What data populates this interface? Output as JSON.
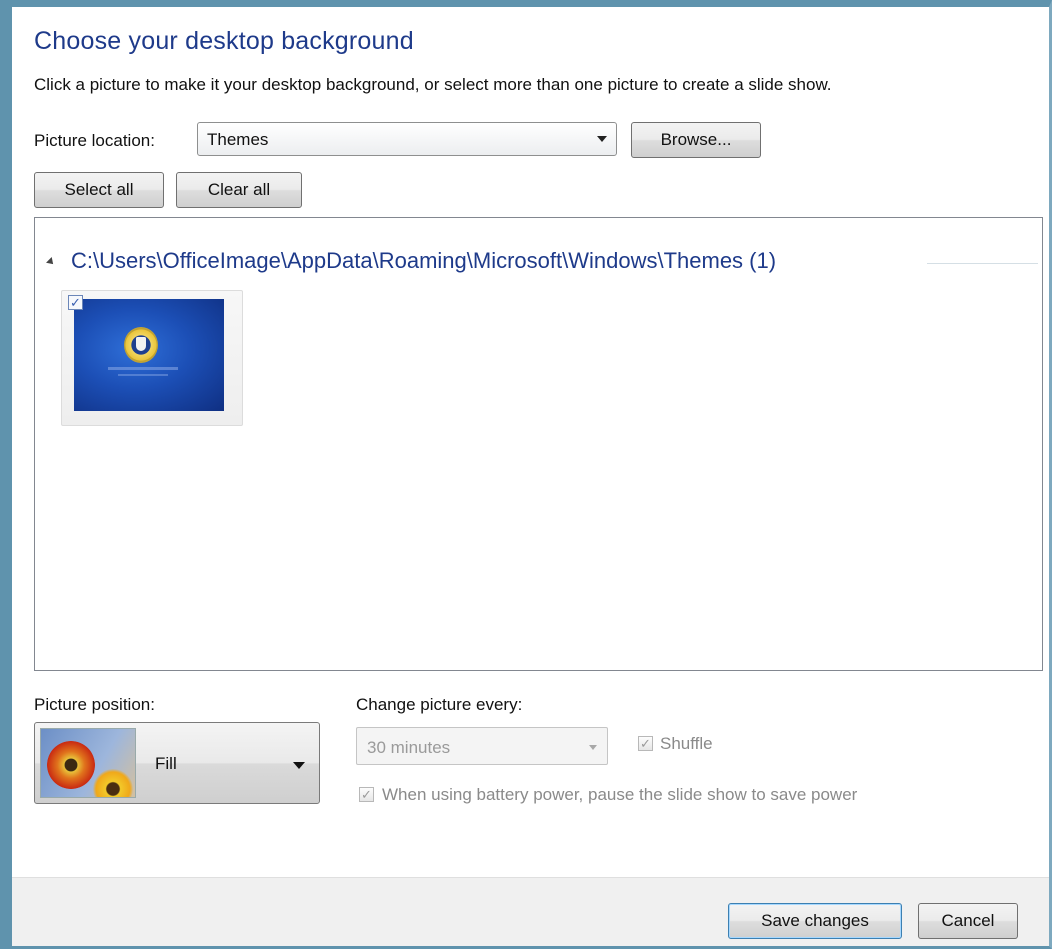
{
  "header": {
    "title": "Choose your desktop background",
    "instructions": "Click a picture to make it your desktop background, or select more than one picture to create a slide show."
  },
  "location": {
    "label": "Picture location:",
    "selected": "Themes",
    "browse_label": "Browse..."
  },
  "selection": {
    "select_all_label": "Select all",
    "clear_all_label": "Clear all"
  },
  "gallery": {
    "group_title": "C:\\Users\\OfficeImage\\AppData\\Roaming\\Microsoft\\Windows\\Themes (1)",
    "items": [
      {
        "checked": true,
        "checkmark": "✓"
      }
    ]
  },
  "position": {
    "label": "Picture position:",
    "selected": "Fill"
  },
  "slideshow": {
    "label": "Change picture every:",
    "interval": "30 minutes",
    "shuffle_label": "Shuffle",
    "shuffle_checked": true,
    "battery_label": "When using battery power, pause the slide show to save power",
    "battery_checked": true,
    "checkmark": "✓"
  },
  "footer": {
    "save_label": "Save changes",
    "cancel_label": "Cancel"
  },
  "colors": {
    "frame": "#5f93ad",
    "title_text": "#1e3a8a",
    "footer_bg": "#f0f0f0"
  }
}
